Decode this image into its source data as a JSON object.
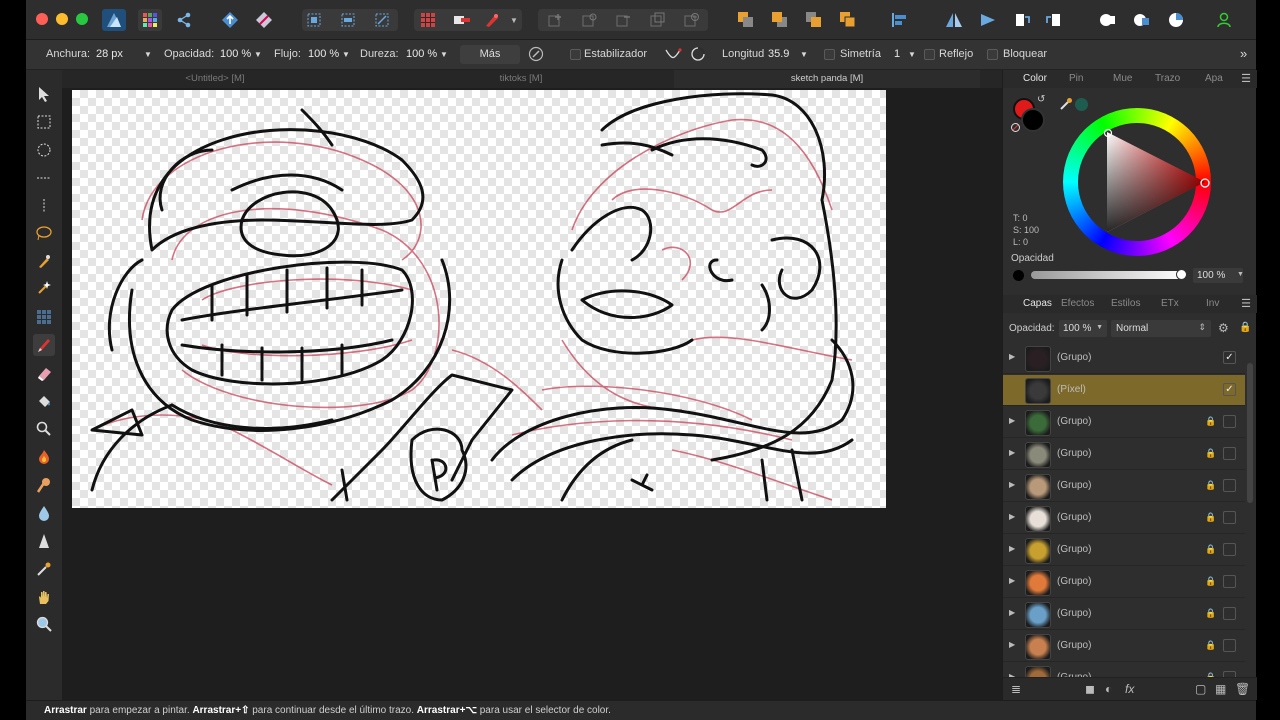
{
  "toolbar": {
    "traffic_colors": [
      "#ff5f57",
      "#febc2e",
      "#28c840"
    ],
    "app_icon": "affinity-photo-icon",
    "icons": [
      "persona-grid-icon",
      "share-icon",
      "export-up-icon",
      "develop-icon",
      "selection-grid-icon",
      "selection-marquee-icon",
      "transform-selection-icon",
      "grid-icon",
      "mask-icon",
      "brush-mask-icon",
      "insert-layer-icon",
      "add-adjust-icon",
      "remove-icon",
      "duplicate-icon",
      "trash-circle-icon",
      "arrange-back-icon",
      "arrange-front-icon",
      "arrange-backward-icon",
      "arrange-forward-icon",
      "align-left-icon",
      "flip-horizontal-icon",
      "flip-vertical-icon",
      "rotate-left-icon",
      "rotate-right-icon",
      "boolean-add-icon",
      "boolean-subtract-icon",
      "boolean-intersect-icon",
      "user-icon"
    ]
  },
  "context": {
    "width_label": "Anchura:",
    "width_value": "28 px",
    "opacity_label": "Opacidad:",
    "opacity_value": "100 %",
    "flow_label": "Flujo:",
    "flow_value": "100 %",
    "hardness_label": "Dureza:",
    "hardness_value": "100 %",
    "more_label": "Más",
    "stabilizer_label": "Estabilizador",
    "length_label": "Longitud",
    "length_value": "35.9",
    "symmetry_label": "Simetría",
    "symmetry_value": "1",
    "mirror_label": "Reflejo",
    "lock_label": "Bloquear"
  },
  "tabs": [
    {
      "label": "<Untitled> [M]",
      "active": false
    },
    {
      "label": "tiktoks [M]",
      "active": false
    },
    {
      "label": "sketch panda [M]",
      "active": true
    }
  ],
  "tools": [
    "move-icon",
    "rect-marquee-icon",
    "ellipse-marquee-icon",
    "row-marquee-icon",
    "column-marquee-icon",
    "freehand-selection-icon",
    "selection-brush-icon",
    "flood-select-icon",
    "pixel-grid-icon",
    "paint-brush-icon",
    "erase-brush-icon",
    "flood-fill-icon",
    "blur-brush-icon",
    "burn-brush-icon",
    "smudge-brush-icon",
    "drop-icon",
    "sharpen-icon",
    "color-picker-icon",
    "hand-icon",
    "zoom-icon"
  ],
  "color_panel": {
    "tabs": [
      "Color",
      "Pin",
      "Mue",
      "Trazo",
      "Apa"
    ],
    "active_tab": "Color",
    "primary_color": "#e01a1a",
    "secondary_color": "#000000",
    "picker_color": "#1f5c50",
    "t_label": "T: 0",
    "s_label": "S: 100",
    "l_label": "L: 0",
    "opacity_label": "Opacidad",
    "opacity_value": "100 %"
  },
  "layers_panel": {
    "tabs": [
      "Capas",
      "Efectos",
      "Estilos",
      "ETx",
      "Inv"
    ],
    "active_tab": "Capas",
    "opacity_label": "Opacidad:",
    "opacity_value": "100 %",
    "blend_mode": "Normal",
    "layers": [
      {
        "name": "(Grupo)",
        "selected": false,
        "locked": false,
        "visible": true,
        "thumb": "#2a2024"
      },
      {
        "name": "(Píxel)",
        "selected": true,
        "locked": false,
        "visible": true,
        "thumb": "#3a3a3a"
      },
      {
        "name": "(Grupo)",
        "selected": false,
        "locked": true,
        "visible": false,
        "thumb": "#3c6b3a"
      },
      {
        "name": "(Grupo)",
        "selected": false,
        "locked": true,
        "visible": false,
        "thumb": "#8a8a7a"
      },
      {
        "name": "(Grupo)",
        "selected": false,
        "locked": true,
        "visible": false,
        "thumb": "#b89a7a"
      },
      {
        "name": "(Grupo)",
        "selected": false,
        "locked": true,
        "visible": false,
        "thumb": "#e8e0d8"
      },
      {
        "name": "(Grupo)",
        "selected": false,
        "locked": true,
        "visible": false,
        "thumb": "#c8a030"
      },
      {
        "name": "(Grupo)",
        "selected": false,
        "locked": true,
        "visible": false,
        "thumb": "#e07a3a"
      },
      {
        "name": "(Grupo)",
        "selected": false,
        "locked": true,
        "visible": false,
        "thumb": "#6aa0c8"
      },
      {
        "name": "(Grupo)",
        "selected": false,
        "locked": true,
        "visible": false,
        "thumb": "#c88050"
      },
      {
        "name": "(Grupo)",
        "selected": false,
        "locked": true,
        "visible": false,
        "thumb": "#a06a3a"
      }
    ],
    "bottom_icons": [
      "layers-stack-icon",
      "mask-layer-icon",
      "adjustment-icon",
      "fx-icon",
      "new-pixel-layer-icon",
      "new-group-icon",
      "delete-layer-icon"
    ]
  },
  "status": {
    "drag": "Arrastrar",
    "t1": " para empezar a pintar. ",
    "drag_shift": "Arrastrar+⇧",
    "t2": " para continuar desde el último trazo. ",
    "drag_alt": "Arrastrar+⌥",
    "t3": " para usar el selector de color."
  }
}
